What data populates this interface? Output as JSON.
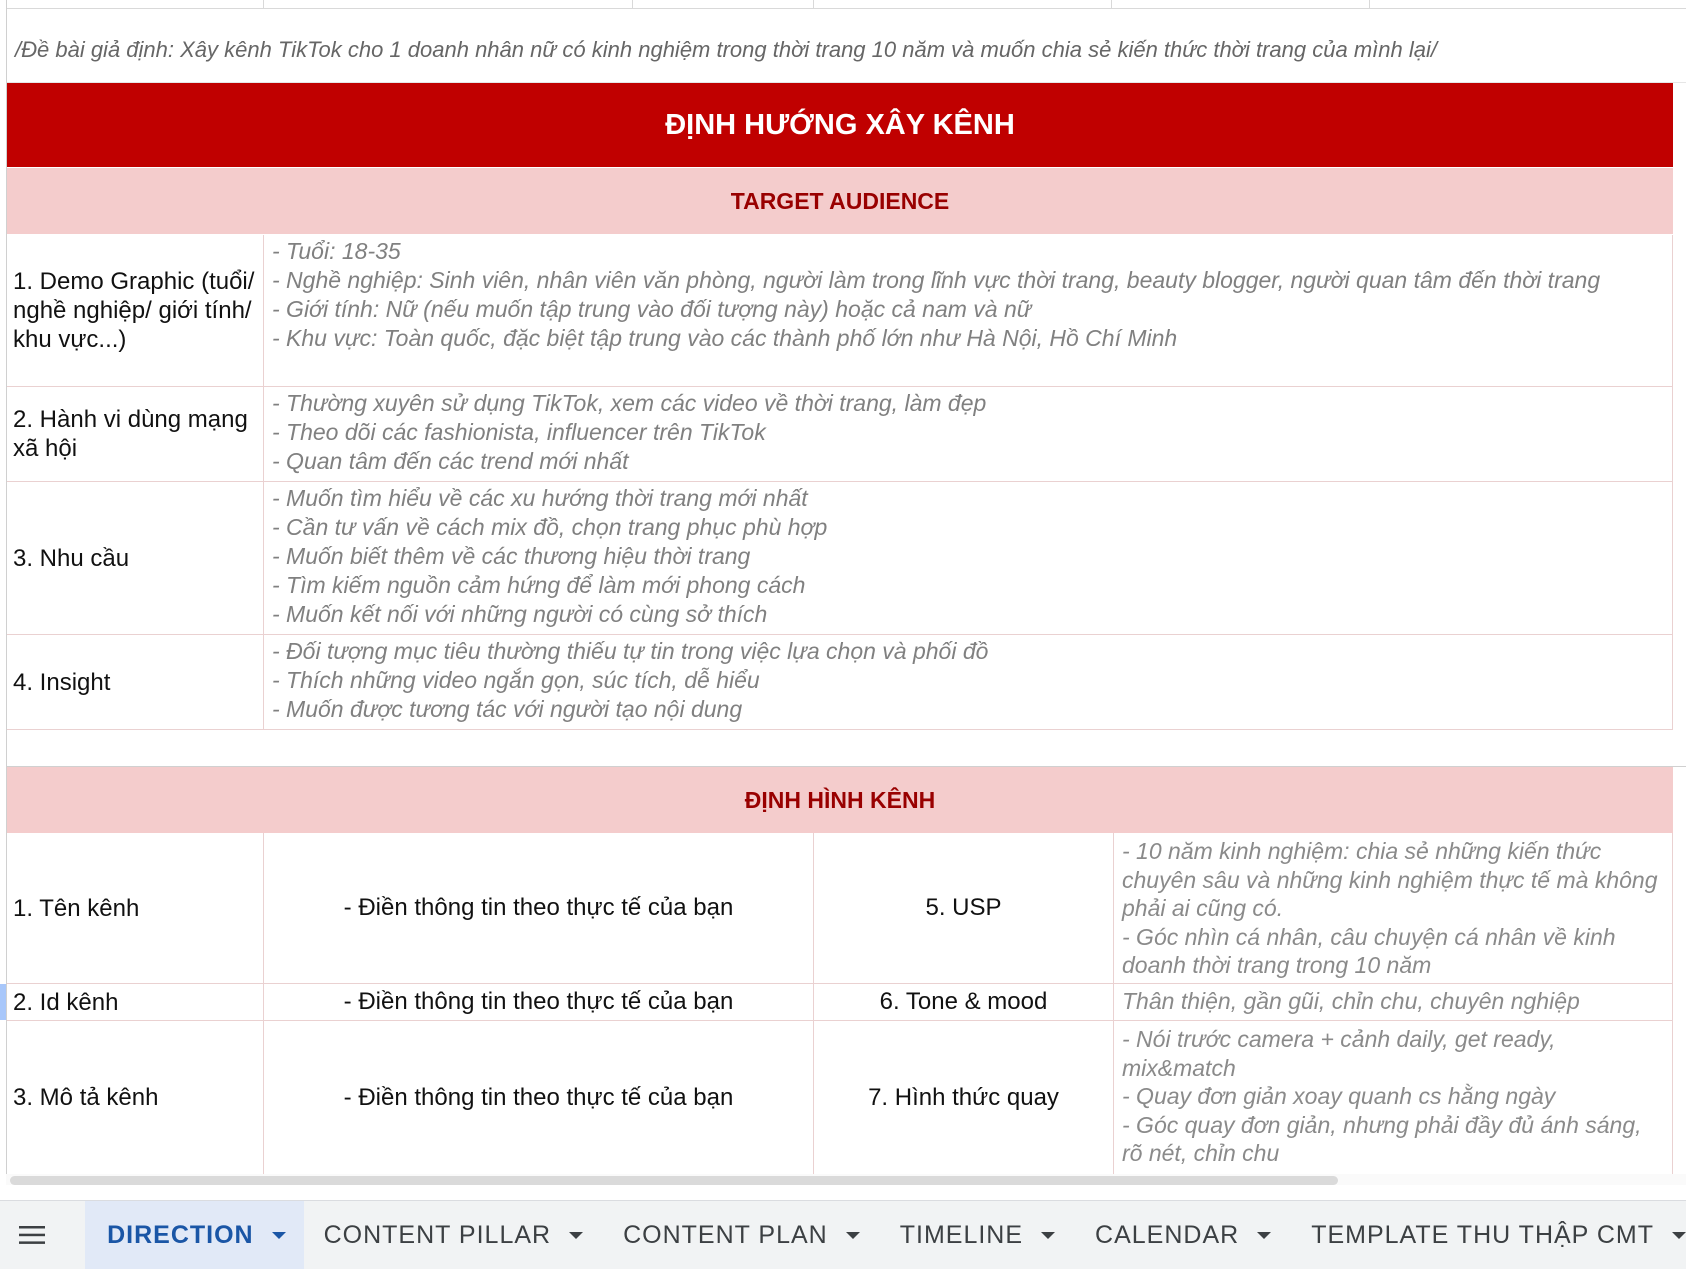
{
  "note": "/Đề bài giả định: Xây kênh TikTok cho 1 doanh nhân nữ có kinh nghiệm trong thời trang 10 năm và muốn chia sẻ kiến thức thời trang của mình lại/",
  "banner": "ĐỊNH HƯỚNG XÂY KÊNH",
  "target": {
    "title": "TARGET AUDIENCE",
    "rows": [
      {
        "label": "1. Demo Graphic (tuổi/ nghề nghiệp/ giới tính/ khu vực...)",
        "lines": [
          "- Tuổi: 18-35",
          "- Nghề nghiệp: Sinh viên, nhân viên văn phòng, người làm trong lĩnh vực thời trang, beauty blogger, người quan tâm đến thời trang",
          "- Giới tính: Nữ (nếu muốn tập trung vào đối tượng này) hoặc cả nam và nữ",
          "- Khu vực: Toàn quốc, đặc biệt tập trung vào các thành phố lớn như Hà Nội, Hồ Chí Minh"
        ]
      },
      {
        "label": "2. Hành vi dùng mạng xã hội",
        "lines": [
          "- Thường xuyên sử dụng TikTok, xem các video về thời trang, làm đẹp",
          "- Theo dõi các fashionista, influencer trên TikTok",
          "- Quan tâm đến các trend mới nhất"
        ]
      },
      {
        "label": "3. Nhu cầu",
        "lines": [
          "- Muốn tìm hiểu về các xu hướng thời trang mới nhất",
          "- Cần tư vấn về cách mix đồ, chọn trang phục phù hợp",
          "- Muốn biết thêm về các thương hiệu thời trang",
          "- Tìm kiếm nguồn cảm hứng để làm mới phong cách",
          "- Muốn kết nối với những người có cùng sở thích"
        ]
      },
      {
        "label": "4. Insight",
        "lines": [
          "- Đối tượng mục tiêu thường thiếu tự tin trong việc lựa chọn và phối đồ",
          "- Thích những video ngắn gọn, súc tích, dễ hiểu",
          "- Muốn được tương tác với người tạo nội dung"
        ]
      }
    ]
  },
  "channel": {
    "title": "ĐỊNH HÌNH KÊNH",
    "rows": [
      {
        "label": "1. Tên kênh",
        "value": "- Điền thông tin theo thực tế của bạn",
        "key": "5. USP",
        "detail": [
          "- 10 năm kinh nghiệm: chia sẻ những kiến thức chuyên sâu và những kinh nghiệm thực tế mà không phải ai cũng có.",
          "- Góc nhìn cá nhân, câu chuyện cá nhân về kinh doanh thời trang trong 10 năm"
        ]
      },
      {
        "label": "2. Id kênh",
        "value": "- Điền thông tin theo thực tế của bạn",
        "key": "6. Tone & mood",
        "detail": [
          "Thân thiện, gần gũi, chỉn chu, chuyên nghiệp"
        ]
      },
      {
        "label": "3. Mô tả kênh",
        "value": "- Điền thông tin theo thực tế của bạn",
        "key": "7. Hình thức quay",
        "detail": [
          "- Nói trước camera + cảnh daily, get ready, mix&match",
          "- Quay đơn giản xoay quanh cs hằng ngày",
          "- Góc quay đơn giản, nhưng phải đầy đủ ánh sáng, rõ nét, chỉn chu"
        ]
      }
    ]
  },
  "tabs": [
    {
      "label": "DIRECTION",
      "active": true
    },
    {
      "label": "CONTENT PILLAR",
      "active": false
    },
    {
      "label": "CONTENT PLAN",
      "active": false
    },
    {
      "label": "TIMELINE",
      "active": false
    },
    {
      "label": "CALENDAR",
      "active": false
    },
    {
      "label": "TEMPLATE THU THẬP CMT",
      "active": false
    }
  ],
  "icons": {
    "menu": "hamburger-menu-icon",
    "tab_dropdown": "caret-down-icon"
  },
  "colors": {
    "banner_bg": "#c00000",
    "section_bg": "#f4cccc",
    "section_text": "#990000",
    "active_tab_text": "#1a56a6",
    "active_tab_bg": "#e1e9f7"
  }
}
